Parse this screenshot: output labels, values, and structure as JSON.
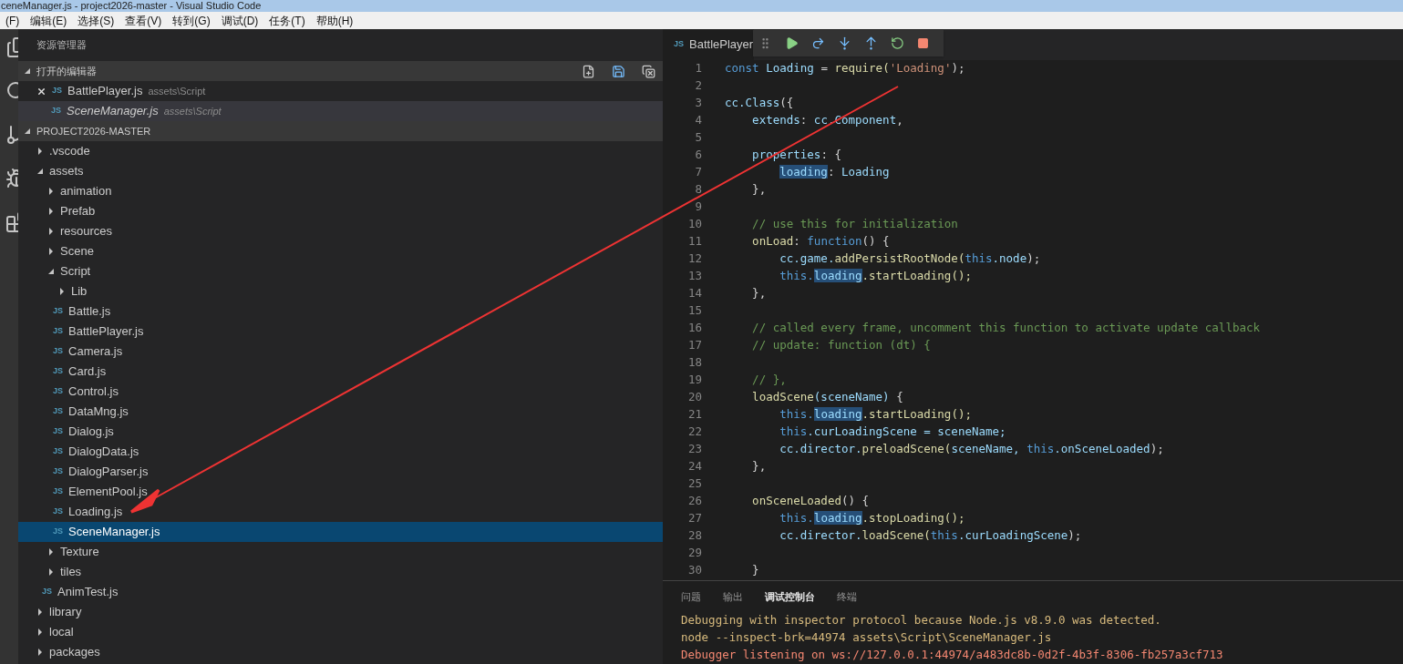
{
  "window": {
    "title": "ceneManager.js - project2026-master - Visual Studio Code"
  },
  "menu": [
    "(F)",
    "编辑(E)",
    "选择(S)",
    "查看(V)",
    "转到(G)",
    "调试(D)",
    "任务(T)",
    "帮助(H)"
  ],
  "sidebar": {
    "title": "资源管理器",
    "open_editors": {
      "label": "打开的编辑器",
      "expanded": true,
      "items": [
        {
          "name": "BattlePlayer.js",
          "path": "assets\\Script",
          "badge": "JS",
          "selected": false,
          "preview": false
        },
        {
          "name": "SceneManager.js",
          "path": "assets\\Script",
          "badge": "JS",
          "selected": true,
          "preview": true
        }
      ]
    },
    "project": {
      "label": "PROJECT2026-MASTER",
      "expanded": true,
      "tree": [
        {
          "kind": "folder",
          "name": ".vscode",
          "expanded": false,
          "selected": false
        },
        {
          "kind": "folder",
          "name": "assets",
          "expanded": true,
          "selected": false,
          "children": [
            {
              "kind": "folder",
              "name": "animation",
              "expanded": false,
              "selected": false
            },
            {
              "kind": "folder",
              "name": "Prefab",
              "expanded": false,
              "selected": false
            },
            {
              "kind": "folder",
              "name": "resources",
              "expanded": false,
              "selected": false
            },
            {
              "kind": "folder",
              "name": "Scene",
              "expanded": false,
              "selected": false
            },
            {
              "kind": "folder",
              "name": "Script",
              "expanded": true,
              "selected": false,
              "children": [
                {
                  "kind": "folder",
                  "name": "Lib",
                  "expanded": false,
                  "selected": false
                },
                {
                  "kind": "file",
                  "name": "Battle.js",
                  "badge": "JS",
                  "selected": false
                },
                {
                  "kind": "file",
                  "name": "BattlePlayer.js",
                  "badge": "JS",
                  "selected": false
                },
                {
                  "kind": "file",
                  "name": "Camera.js",
                  "badge": "JS",
                  "selected": false
                },
                {
                  "kind": "file",
                  "name": "Card.js",
                  "badge": "JS",
                  "selected": false
                },
                {
                  "kind": "file",
                  "name": "Control.js",
                  "badge": "JS",
                  "selected": false
                },
                {
                  "kind": "file",
                  "name": "DataMng.js",
                  "badge": "JS",
                  "selected": false
                },
                {
                  "kind": "file",
                  "name": "Dialog.js",
                  "badge": "JS",
                  "selected": false
                },
                {
                  "kind": "file",
                  "name": "DialogData.js",
                  "badge": "JS",
                  "selected": false
                },
                {
                  "kind": "file",
                  "name": "DialogParser.js",
                  "badge": "JS",
                  "selected": false
                },
                {
                  "kind": "file",
                  "name": "ElementPool.js",
                  "badge": "JS",
                  "selected": false
                },
                {
                  "kind": "file",
                  "name": "Loading.js",
                  "badge": "JS",
                  "selected": false
                },
                {
                  "kind": "file",
                  "name": "SceneManager.js",
                  "badge": "JS",
                  "selected": true
                }
              ]
            },
            {
              "kind": "folder",
              "name": "Texture",
              "expanded": false,
              "selected": false
            },
            {
              "kind": "folder",
              "name": "tiles",
              "expanded": false,
              "selected": false
            },
            {
              "kind": "file",
              "name": "AnimTest.js",
              "badge": "JS",
              "selected": false
            }
          ]
        },
        {
          "kind": "folder",
          "name": "library",
          "expanded": false,
          "selected": false
        },
        {
          "kind": "folder",
          "name": "local",
          "expanded": false,
          "selected": false
        },
        {
          "kind": "folder",
          "name": "packages",
          "expanded": false,
          "selected": false
        }
      ]
    }
  },
  "editor": {
    "tab": {
      "badge": "JS",
      "name": "BattlePlayer"
    },
    "lines": [
      {
        "n": "1",
        "tokens": [
          {
            "kind": "keyword",
            "t": "const"
          },
          {
            "kind": "name",
            "t": "Loading"
          },
          {
            "kind": "plain",
            "t": "="
          },
          {
            "kind": "call",
            "t": "require("
          },
          {
            "kind": "string",
            "t": "'Loading'"
          },
          {
            "kind": "plain",
            "t": ");"
          }
        ]
      },
      {
        "n": "2"
      },
      {
        "n": "3",
        "tokens": [
          {
            "kind": "name",
            "t": "cc.Class"
          },
          {
            "kind": "plain",
            "t": "({"
          }
        ]
      },
      {
        "n": "4",
        "tokens": [
          {
            "kind": "name",
            "t": "    extends"
          },
          {
            "kind": "plain",
            "t": ":"
          },
          {
            "kind": "name",
            "t": "cc.Component"
          },
          {
            "kind": "plain",
            "t": ","
          }
        ]
      },
      {
        "n": "5"
      },
      {
        "n": "6",
        "tokens": [
          {
            "kind": "name",
            "t": "    properties"
          },
          {
            "kind": "plain",
            "t": ": {"
          }
        ]
      },
      {
        "n": "7",
        "tokens": [
          {
            "kind": "highlight",
            "t": "        loading"
          },
          {
            "kind": "plain",
            "t": ":"
          },
          {
            "kind": "name",
            "t": "Loading"
          }
        ]
      },
      {
        "n": "8",
        "tokens": [
          {
            "kind": "plain",
            "t": "    },"
          }
        ]
      },
      {
        "n": "9"
      },
      {
        "n": "10",
        "tokens": [
          {
            "kind": "comment",
            "t": "    // use this for initialization"
          }
        ]
      },
      {
        "n": "11",
        "tokens": [
          {
            "kind": "call",
            "t": "    onLoad"
          },
          {
            "kind": "plain",
            "t": ":"
          },
          {
            "kind": "keyword",
            "t": "function"
          },
          {
            "kind": "plain",
            "t": "() {"
          }
        ]
      },
      {
        "n": "12",
        "tokens": [
          {
            "kind": "name",
            "t": "        cc.game."
          },
          {
            "kind": "call",
            "t": "addPersistRootNode("
          },
          {
            "kind": "keyword",
            "t": "this"
          },
          {
            "kind": "name",
            "t": ".node"
          },
          {
            "kind": "plain",
            "t": ");"
          }
        ]
      },
      {
        "n": "13",
        "tokens": [
          {
            "kind": "keyword",
            "t": "        this."
          },
          {
            "kind": "highlight",
            "t": "loading"
          },
          {
            "kind": "call",
            "t": ".startLoading();"
          }
        ]
      },
      {
        "n": "14",
        "tokens": [
          {
            "kind": "plain",
            "t": "    },"
          }
        ]
      },
      {
        "n": "15"
      },
      {
        "n": "16",
        "tokens": [
          {
            "kind": "comment",
            "t": "    // called every frame, uncomment this function to activate update callback"
          }
        ]
      },
      {
        "n": "17",
        "tokens": [
          {
            "kind": "comment",
            "t": "    // update: function (dt) {"
          }
        ]
      },
      {
        "n": "18"
      },
      {
        "n": "19",
        "tokens": [
          {
            "kind": "comment",
            "t": "    // },"
          }
        ]
      },
      {
        "n": "20",
        "tokens": [
          {
            "kind": "call",
            "t": "    loadScene"
          },
          {
            "kind": "name",
            "t": "(sceneName)"
          },
          {
            "kind": "plain",
            "t": "{"
          }
        ]
      },
      {
        "n": "21",
        "tokens": [
          {
            "kind": "keyword",
            "t": "        this."
          },
          {
            "kind": "highlight",
            "t": "loading"
          },
          {
            "kind": "call",
            "t": ".startLoading();"
          }
        ]
      },
      {
        "n": "22",
        "tokens": [
          {
            "kind": "keyword",
            "t": "        this"
          },
          {
            "kind": "name",
            "t": ".curLoadingScene = sceneName;"
          }
        ]
      },
      {
        "n": "23",
        "tokens": [
          {
            "kind": "name",
            "t": "        cc.director."
          },
          {
            "kind": "call",
            "t": "preloadScene("
          },
          {
            "kind": "name",
            "t": "sceneName,"
          },
          {
            "kind": "keyword",
            "t": "this"
          },
          {
            "kind": "name",
            "t": ".onSceneLoaded"
          },
          {
            "kind": "plain",
            "t": ");"
          }
        ]
      },
      {
        "n": "24",
        "tokens": [
          {
            "kind": "plain",
            "t": "    },"
          }
        ]
      },
      {
        "n": "25"
      },
      {
        "n": "26",
        "tokens": [
          {
            "kind": "call",
            "t": "    onSceneLoaded"
          },
          {
            "kind": "plain",
            "t": "() {"
          }
        ]
      },
      {
        "n": "27",
        "tokens": [
          {
            "kind": "keyword",
            "t": "        this."
          },
          {
            "kind": "highlight",
            "t": "loading"
          },
          {
            "kind": "call",
            "t": ".stopLoading();"
          }
        ]
      },
      {
        "n": "28",
        "tokens": [
          {
            "kind": "name",
            "t": "        cc.director."
          },
          {
            "kind": "call",
            "t": "loadScene("
          },
          {
            "kind": "keyword",
            "t": "this"
          },
          {
            "kind": "name",
            "t": ".curLoadingScene"
          },
          {
            "kind": "plain",
            "t": ");"
          }
        ]
      },
      {
        "n": "29"
      },
      {
        "n": "30",
        "tokens": [
          {
            "kind": "plain",
            "t": "    }"
          }
        ]
      }
    ]
  },
  "panel": {
    "tabs": [
      {
        "label": "问题",
        "selected": false
      },
      {
        "label": "输出",
        "selected": false
      },
      {
        "label": "调试控制台",
        "selected": true
      },
      {
        "label": "终端",
        "selected": false
      }
    ],
    "output": [
      {
        "kind": "info",
        "text": "Debugging with inspector protocol because Node.js v8.9.0 was detected."
      },
      {
        "kind": "info",
        "text": "node --inspect-brk=44974 assets\\Script\\SceneManager.js"
      },
      {
        "kind": "error",
        "text": "Debugger listening on ws://127.0.0.1:44974/a483dc8b-0d2f-4b3f-8306-fb257a3cf713"
      }
    ]
  }
}
